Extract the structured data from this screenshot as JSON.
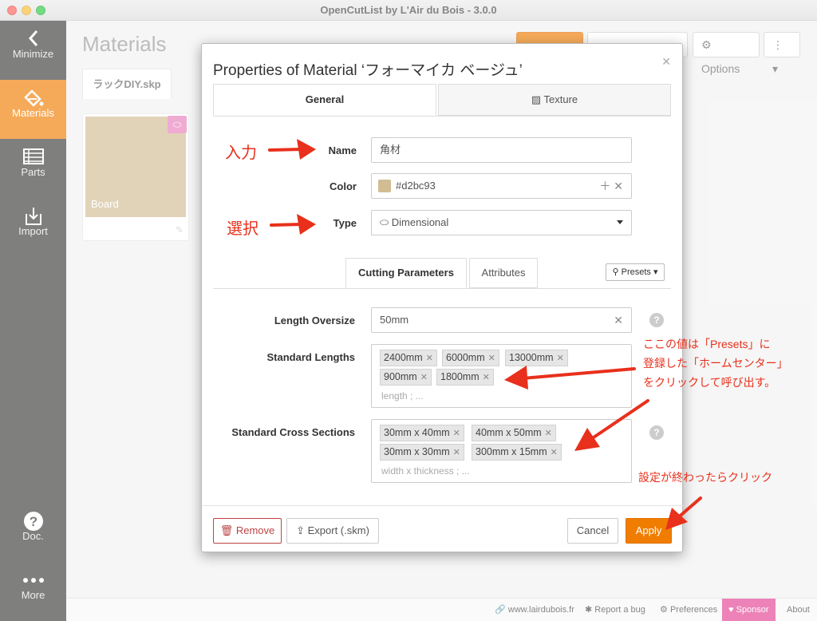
{
  "window": {
    "title": "OpenCutList by L'Air du Bois - 3.0.0"
  },
  "sidebar": {
    "items": [
      {
        "label": "Minimize",
        "icon": "chevron-left-icon"
      },
      {
        "label": "Materials",
        "icon": "paint-bucket-icon"
      },
      {
        "label": "Parts",
        "icon": "list-icon"
      },
      {
        "label": "Import",
        "icon": "import-icon"
      },
      {
        "label": "Doc.",
        "icon": "help-circle-icon"
      },
      {
        "label": "More",
        "icon": "more-dots-icon"
      }
    ],
    "active": "Materials"
  },
  "page": {
    "title": "Materials",
    "buttons": {
      "options": "Options"
    },
    "file_tab": "ラックDIY.skp",
    "material_card": {
      "label": "Board"
    }
  },
  "footer": {
    "website": "www.lairdubois.fr",
    "report": "Report a bug",
    "preferences": "Preferences",
    "sponsor": "Sponsor",
    "about": "About"
  },
  "modal": {
    "title": "Properties of Material ‘フォーマイカ ベージュ’",
    "tabs": [
      "General",
      "Texture"
    ],
    "active_tab": "General",
    "fields": {
      "name": {
        "label": "Name",
        "value": "角材"
      },
      "color": {
        "label": "Color",
        "value": "#d2bc93"
      },
      "type": {
        "label": "Type",
        "value": "Dimensional"
      }
    },
    "subtabs": [
      "Cutting Parameters",
      "Attributes"
    ],
    "active_subtab": "Cutting Parameters",
    "presets_label": "Presets",
    "length_oversize": {
      "label": "Length Oversize",
      "value": "50mm"
    },
    "standard_lengths": {
      "label": "Standard Lengths",
      "tags": [
        "2400mm",
        "6000mm",
        "13000mm",
        "900mm",
        "1800mm"
      ],
      "placeholder": "length ; ..."
    },
    "standard_cross_sections": {
      "label": "Standard Cross Sections",
      "tags": [
        "30mm x 40mm",
        "40mm x 50mm",
        "30mm x 30mm",
        "300mm x 15mm"
      ],
      "placeholder": "width x thickness ; ..."
    },
    "buttons": {
      "remove": "Remove",
      "export": "Export (.skm)",
      "cancel": "Cancel",
      "apply": "Apply"
    }
  },
  "annotations": {
    "input": "入力",
    "select": "選択",
    "presets_note": [
      "ここの値は「Presets」に",
      "登録した「ホームセンター」",
      "をクリックして呼び出す。"
    ],
    "apply_note": "設定が終わったらクリック",
    "color": "#e8301c"
  },
  "colors": {
    "accent": "#f07d00",
    "sidebar": "#3b3b39",
    "material": "#d2bc93",
    "sponsor": "#e23f93"
  }
}
